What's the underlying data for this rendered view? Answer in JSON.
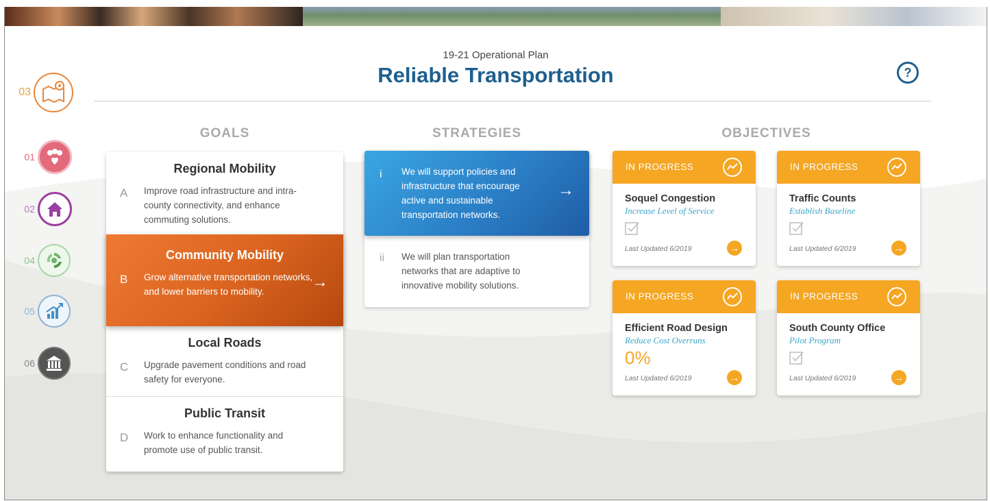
{
  "header": {
    "subtitle": "19-21 Operational Plan",
    "title": "Reliable Transportation",
    "help_glyph": "?"
  },
  "nav": [
    {
      "num": "03",
      "icon": "map-pin-icon",
      "color": "#e8863a",
      "active": true
    },
    {
      "num": "01",
      "icon": "people-heart-icon",
      "color": "#e26a7a"
    },
    {
      "num": "02",
      "icon": "home-icon",
      "color": "#9b3fa0"
    },
    {
      "num": "04",
      "icon": "recycle-leaf-icon",
      "color": "#6db36a"
    },
    {
      "num": "05",
      "icon": "growth-chart-icon",
      "color": "#3f8fc8"
    },
    {
      "num": "06",
      "icon": "government-building-icon",
      "color": "#555555"
    }
  ],
  "columns": {
    "goals": "GOALS",
    "strategies": "STRATEGIES",
    "objectives": "OBJECTIVES"
  },
  "goals": [
    {
      "letter": "A",
      "title": "Regional Mobility",
      "text": "Improve road infrastructure and intra-county connectivity, and enhance commuting solutions."
    },
    {
      "letter": "B",
      "title": "Community Mobility",
      "text": "Grow alternative transportation networks, and lower barriers to mobility.",
      "arrow": "→",
      "active": true
    },
    {
      "letter": "C",
      "title": "Local Roads",
      "text": "Upgrade pavement conditions and road safety for everyone."
    },
    {
      "letter": "D",
      "title": "Public Transit",
      "text": "Work to enhance functionality and promote use of public transit."
    }
  ],
  "strategies": [
    {
      "num": "i",
      "text": "We will support policies and infrastructure that encourage active and sustainable transportation networks.",
      "arrow": "→",
      "active": true
    },
    {
      "num": "ii",
      "text": "We will plan transportation networks that are adaptive to innovative mobility solutions."
    }
  ],
  "objectives": [
    {
      "status": "IN PROGRESS",
      "title": "Soquel Congestion",
      "subtitle": "Increase Level of Service",
      "updated": "Last Updated 6/2019",
      "go": "→"
    },
    {
      "status": "IN PROGRESS",
      "title": "Traffic Counts",
      "subtitle": "Establish Baseline",
      "updated": "Last Updated 6/2019",
      "go": "→"
    },
    {
      "status": "IN PROGRESS",
      "title": "Efficient Road Design",
      "subtitle": "Reduce Cost Overruns",
      "percent": "0%",
      "updated": "Last Updated 6/2019",
      "go": "→"
    },
    {
      "status": "IN PROGRESS",
      "title": "South County Office",
      "subtitle": "Pilot Program",
      "updated": "Last Updated 6/2019",
      "go": "→"
    }
  ],
  "colors": {
    "accent_orange": "#f5a623",
    "goal_active": "#d9631f",
    "strategy_active": "#2b7fc6",
    "title_blue": "#1e5f8e"
  }
}
